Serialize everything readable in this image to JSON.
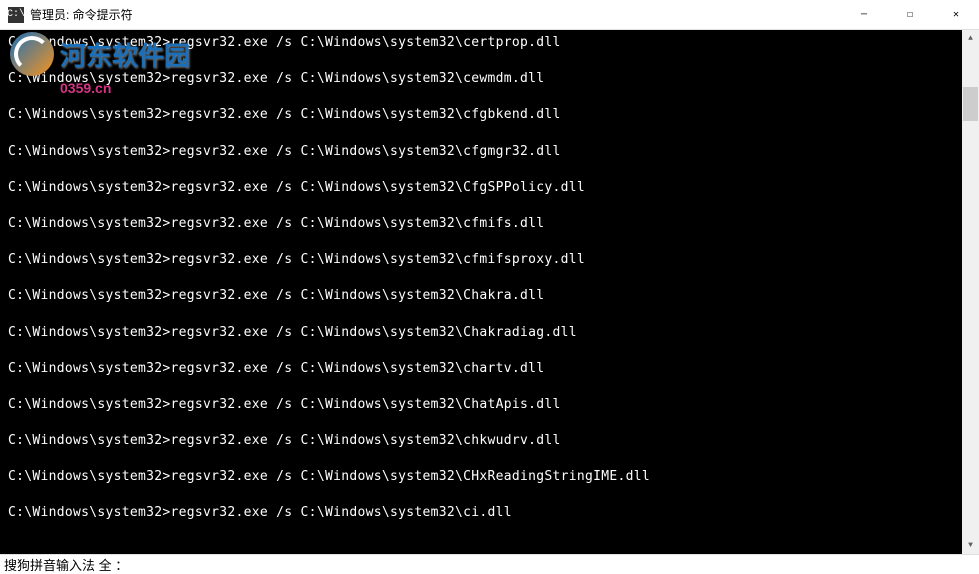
{
  "titlebar": {
    "icon_label": "C:\\",
    "title": "管理员: 命令提示符"
  },
  "window_controls": {
    "minimize": "─",
    "maximize": "☐",
    "close": "✕"
  },
  "console": {
    "prompt": "C:\\Windows\\system32>",
    "command_prefix": "regsvr32.exe /s C:\\Windows\\system32\\",
    "lines": [
      "C:\\Windows\\system32>regsvr32.exe /s C:\\Windows\\system32\\certprop.dll",
      "C:\\Windows\\system32>regsvr32.exe /s C:\\Windows\\system32\\cewmdm.dll",
      "C:\\Windows\\system32>regsvr32.exe /s C:\\Windows\\system32\\cfgbkend.dll",
      "C:\\Windows\\system32>regsvr32.exe /s C:\\Windows\\system32\\cfgmgr32.dll",
      "C:\\Windows\\system32>regsvr32.exe /s C:\\Windows\\system32\\CfgSPPolicy.dll",
      "C:\\Windows\\system32>regsvr32.exe /s C:\\Windows\\system32\\cfmifs.dll",
      "C:\\Windows\\system32>regsvr32.exe /s C:\\Windows\\system32\\cfmifsproxy.dll",
      "C:\\Windows\\system32>regsvr32.exe /s C:\\Windows\\system32\\Chakra.dll",
      "C:\\Windows\\system32>regsvr32.exe /s C:\\Windows\\system32\\Chakradiag.dll",
      "C:\\Windows\\system32>regsvr32.exe /s C:\\Windows\\system32\\chartv.dll",
      "C:\\Windows\\system32>regsvr32.exe /s C:\\Windows\\system32\\ChatApis.dll",
      "C:\\Windows\\system32>regsvr32.exe /s C:\\Windows\\system32\\chkwudrv.dll",
      "C:\\Windows\\system32>regsvr32.exe /s C:\\Windows\\system32\\CHxReadingStringIME.dll",
      "C:\\Windows\\system32>regsvr32.exe /s C:\\Windows\\system32\\ci.dll"
    ]
  },
  "scrollbar": {
    "up": "▲",
    "down": "▼"
  },
  "ime": {
    "text": "搜狗拼音输入法 全 ："
  },
  "watermark": {
    "brand": "河东软件园",
    "url": "0359.cn"
  }
}
